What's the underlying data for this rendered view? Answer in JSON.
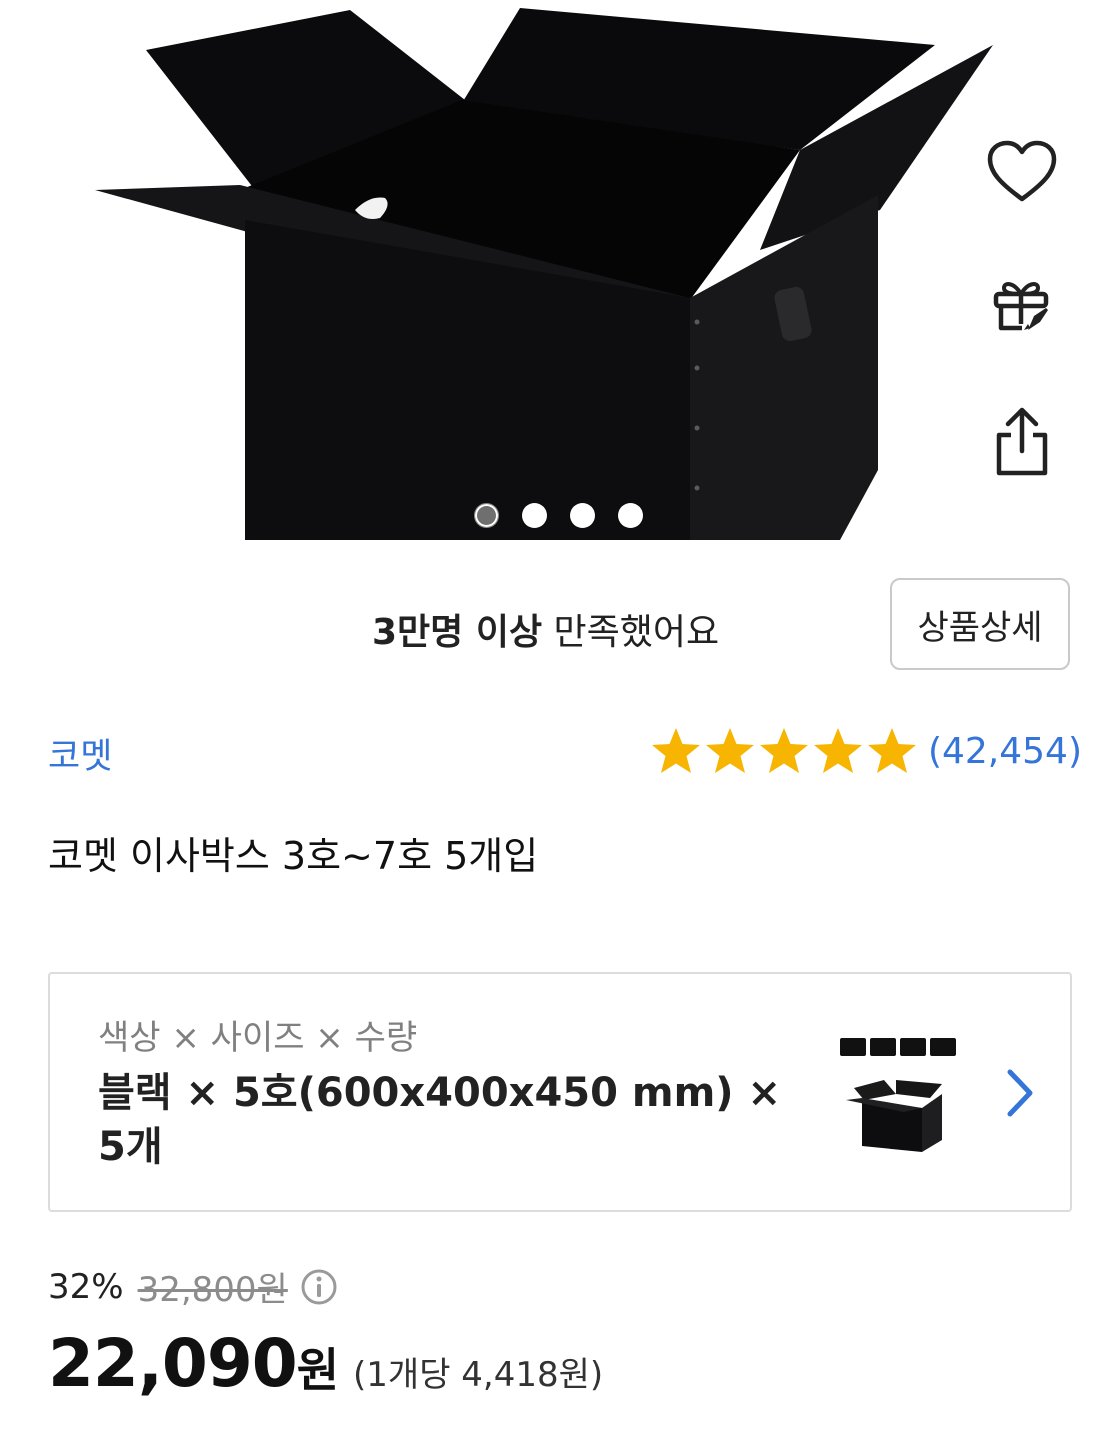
{
  "gallery": {
    "image_alt": "black moving box product photo",
    "slide_count": 4,
    "active_slide": 1
  },
  "actions": {
    "wishlist_icon": "heart-outline-icon",
    "gift_icon": "gift-rocket-icon",
    "share_icon": "share-icon"
  },
  "satisfaction": {
    "bold": "3만명 이상",
    "rest": " 만족했어요",
    "detail_button": "상품상세"
  },
  "product": {
    "brand": "코멧",
    "rating": 5,
    "review_count": "(42,454)",
    "title": "코멧 이사박스 3호~7호 5개입"
  },
  "option": {
    "label": "색상 × 사이즈 × 수량",
    "value": "블랙 × 5호(600x400x450 mm) × 5개"
  },
  "price": {
    "discount_rate": "32%",
    "original": "32,800원",
    "final_number": "22,090",
    "final_unit": "원",
    "unit_price": "(1개당 4,418원)"
  },
  "colors": {
    "accent_blue": "#3574d8",
    "star": "#f7b400",
    "box_black": "#0d0d0f"
  }
}
